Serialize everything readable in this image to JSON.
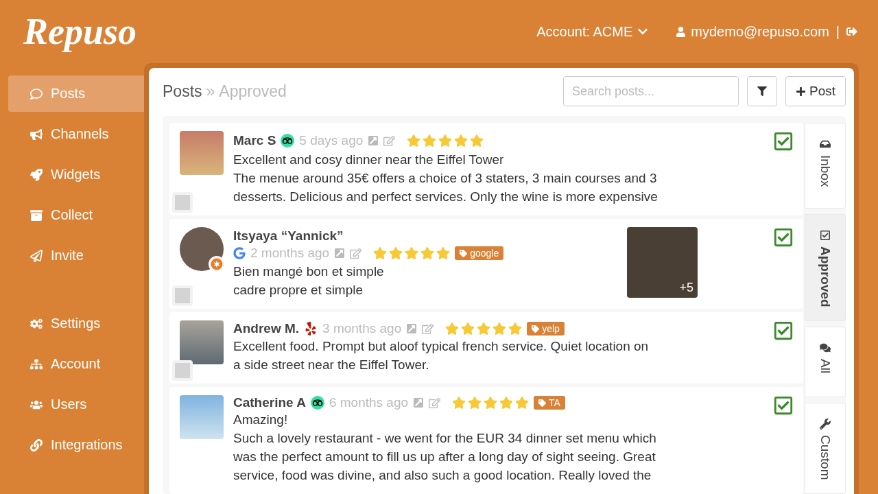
{
  "header": {
    "logo": "Repuso",
    "account": "Account: ACME",
    "user": "mydemo@repuso.com",
    "separator": "|"
  },
  "sidebar": {
    "main": [
      {
        "label": "Posts",
        "selected": true
      },
      {
        "label": "Channels",
        "selected": false
      },
      {
        "label": "Widgets",
        "selected": false
      },
      {
        "label": "Collect",
        "selected": false
      },
      {
        "label": "Invite",
        "selected": false
      }
    ],
    "admin": [
      {
        "label": "Settings",
        "selected": false
      },
      {
        "label": "Account",
        "selected": false
      },
      {
        "label": "Users",
        "selected": false
      },
      {
        "label": "Integrations",
        "selected": false
      }
    ]
  },
  "panel": {
    "breadcrumb": "Posts",
    "separator": "»",
    "current": "Approved",
    "search": {
      "placeholder": "Search posts..."
    },
    "new_button": "Post"
  },
  "posts": [
    {
      "author": "Marc S",
      "source": {
        "kind": "tripadvisor"
      },
      "avatar": {
        "kind": "square"
      },
      "time": "5 days ago",
      "stars": 5,
      "lines": [
        "Excellent and cosy dinner near the Eiffel Tower",
        "The menue around 35€ offers a choice of 3 staters, 3 main courses and 3",
        "desserts. Delicious and perfect services. Only the wine is more expensive"
      ],
      "selected": false,
      "approved": true
    },
    {
      "author": "Itsyaya “Yannick”",
      "source": {
        "kind": "google"
      },
      "avatar": {
        "kind": "round"
      },
      "time": "2 months ago",
      "stars": 5,
      "tag": "google",
      "lines": [
        "Bien mangé bon et simple",
        "cadre propre et simple"
      ],
      "photo_count": "+5",
      "selected": false,
      "approved": true
    },
    {
      "author": "Andrew M.",
      "source": {
        "kind": "yelp"
      },
      "avatar": {
        "kind": "square"
      },
      "time": "3 months ago",
      "stars": 5,
      "tag": "yelp",
      "lines": [
        "Excellent food.  Prompt but aloof typical french service.  Quiet location on",
        "a side street near the Eiffel Tower."
      ],
      "selected": false,
      "approved": true
    },
    {
      "author": "Catherine A",
      "source": {
        "kind": "tripadvisor"
      },
      "avatar": {
        "kind": "square"
      },
      "time": "6 months ago",
      "stars": 5,
      "tag": "TA",
      "lines": [
        "Amazing!",
        "Such a lovely restaurant - we went for the EUR 34 dinner set menu which",
        "was the perfect amount to fill us up after a long day of sight seeing. Great",
        "service, food was divine, and also such a good location. Really loved the"
      ],
      "approved": true
    }
  ],
  "side_tabs": [
    {
      "label": "Inbox",
      "selected": false
    },
    {
      "label": "Approved",
      "selected": true
    },
    {
      "label": "All",
      "selected": false
    },
    {
      "label": "Custom",
      "selected": false
    }
  ]
}
